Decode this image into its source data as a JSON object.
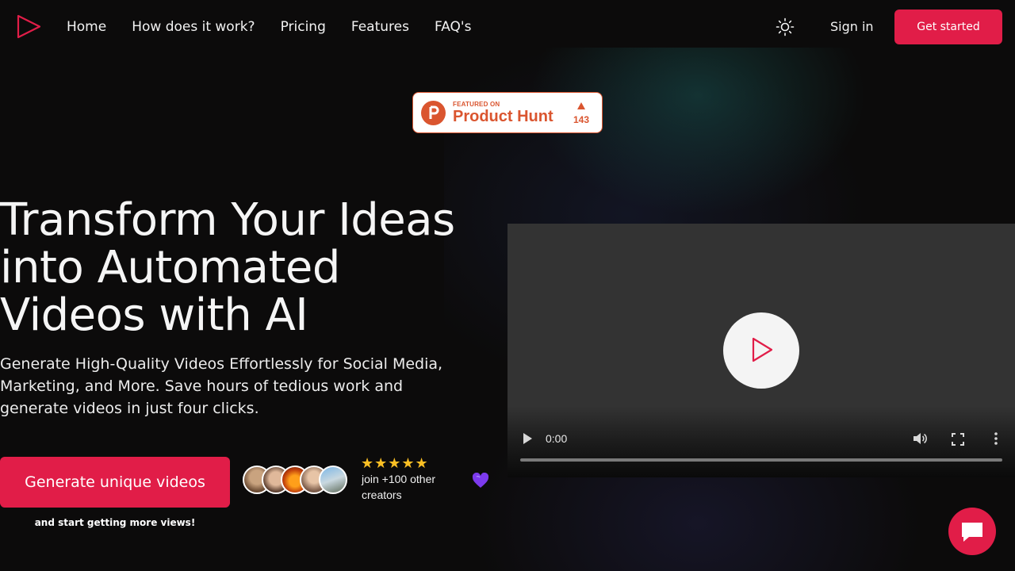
{
  "nav": {
    "links": [
      "Home",
      "How does it work?",
      "Pricing",
      "Features",
      "FAQ's"
    ],
    "sign_in": "Sign in",
    "get_started": "Get started",
    "theme_icon": "sun-icon"
  },
  "product_hunt": {
    "featured_on": "FEATURED ON",
    "name": "Product Hunt",
    "upvotes": "143"
  },
  "hero": {
    "title_lines": [
      "Transform Your Ideas",
      "into Automated",
      "Videos with AI"
    ],
    "subtitle": "Generate High-Quality Videos Effortlessly for Social Media, Marketing, and More. Save hours of tedious work and generate videos in just four clicks.",
    "cta_label": "Generate unique videos",
    "cta_note": "and start getting more views!",
    "rating_stars": "★★★★★",
    "social_proof": "join +100 other creators"
  },
  "video": {
    "current_time": "0:00"
  },
  "colors": {
    "accent": "#e11d48",
    "background": "#0c0b0b",
    "product_hunt": "#da552f",
    "star": "#fbbf24",
    "heart": "#7c3aed"
  }
}
